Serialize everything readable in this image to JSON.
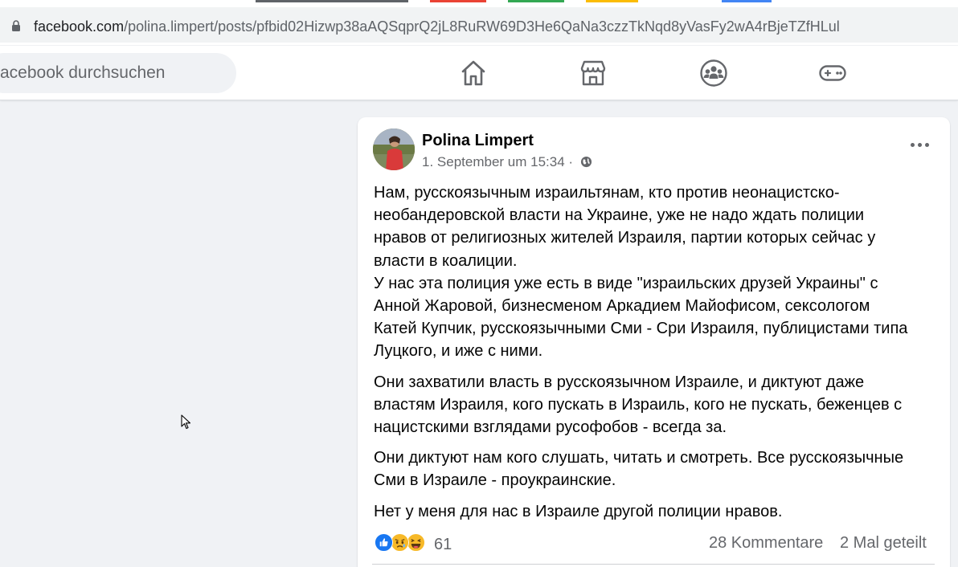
{
  "browser": {
    "url_host": "facebook.com",
    "url_path": "/polina.limpert/posts/pfbid02Hizwp38aAQSqprQ2jL8RuRW69D3He6QaNa3czzTkNqd8yVasFy2wA4rBjeTZfHLul",
    "tab_colors": [
      "#5f6368",
      "#ea4335",
      "#34a853",
      "#fbbc04",
      "#4285f4"
    ]
  },
  "topbar": {
    "search_placeholder": "acebook durchsuchen",
    "nav": [
      "home-icon",
      "marketplace-icon",
      "groups-icon",
      "gaming-icon"
    ]
  },
  "post": {
    "author": "Polina Limpert",
    "timestamp": "1. September um 15:34 ·",
    "paragraphs": [
      [
        "Нам, русскоязычным израильтянам, кто против неонацистско-",
        "необандеровской власти на Украине, уже не надо ждать полиции",
        "нравов от религиозных жителей Израиля, партии которых сейчас у",
        "власти в коалиции.",
        "У нас эта полиция уже есть в виде \"израильских друзей Украины\" с",
        "Анной Жаровой, бизнесменом Аркадием Майофисом, сексологом",
        "Катей Купчик, русскоязычными Сми - Сри Израиля, публицистами типа",
        "Луцкого, и иже с ними."
      ],
      [
        "Они захватили власть в русскоязычном Израиле, и диктуют даже",
        "властям Израиля, кого пускать в Израиль, кого не пускать, беженцев с",
        "нацистскими взглядами русофобов - всегда за."
      ],
      [
        "Они диктуют нам кого слушать, читать и смотреть. Все русскоязычные",
        "Сми в Израиле - проукраинские."
      ],
      [
        "Нет у меня для нас в Израиле другой полиции нравов."
      ]
    ],
    "reaction_count": "61",
    "comments": "28 Kommentare",
    "shares": "2 Mal geteilt",
    "colors": {
      "like": "#1877f2",
      "emoji": "#f7b928"
    }
  }
}
